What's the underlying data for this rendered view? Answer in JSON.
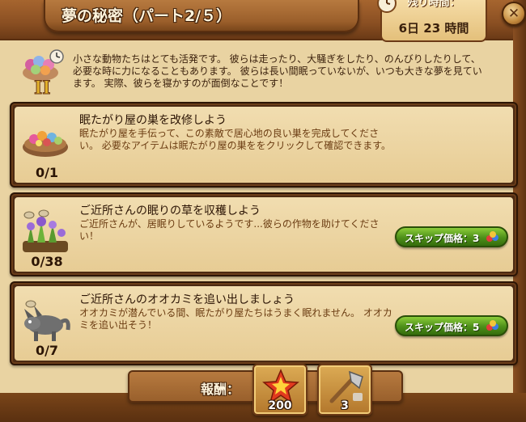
{
  "header": {
    "title": "夢の秘密（パート2/５）",
    "timer_label": "残り時間：",
    "timer_value": "6日 23 時間"
  },
  "intro": {
    "text": "小さな動物たちはとても活発です。 彼らは走ったり、大騒ぎをしたり、のんびりしたりして、必要な時に力になることもあります。 彼らは長い間眠っていないが、いつも大きな夢を見ています。 実際、彼らを寝かすのが面倒なことです！",
    "chapter_badge": "II"
  },
  "quests": [
    {
      "title": "眠たがり屋の巣を改修しよう",
      "description": "眠たがり屋を手伝って、この素敵で居心地の良い巣を完成してください。 必要なアイテムは眠たがり屋の巣ををクリックして確認できます。",
      "progress": "0/1",
      "icon": "nest-icon"
    },
    {
      "title": "ご近所さんの眠りの草を収穫しよう",
      "description": "ご近所さんが、居眠りしているようです...彼らの作物を助けてください！",
      "progress": "0/38",
      "icon": "sleepy-grass-icon",
      "skip_label": "スキップ価格：3"
    },
    {
      "title": "ご近所さんのオオカミを追い出しましょう",
      "description": "オオカミが潜んでいる間、眠たがり屋たちはうまく眠れません。 オオカミを追い出そう！",
      "progress": "0/7",
      "icon": "wolf-icon",
      "skip_label": "スキップ価格：5"
    }
  ],
  "rewards": {
    "label": "報酬：",
    "items": [
      {
        "icon": "star-icon",
        "count": "200"
      },
      {
        "icon": "axe-icon",
        "count": "3"
      }
    ]
  },
  "colors": {
    "skip_button": "#4d8f19",
    "card_border": "#4c2a12",
    "parchment": "#f1ddb0"
  }
}
